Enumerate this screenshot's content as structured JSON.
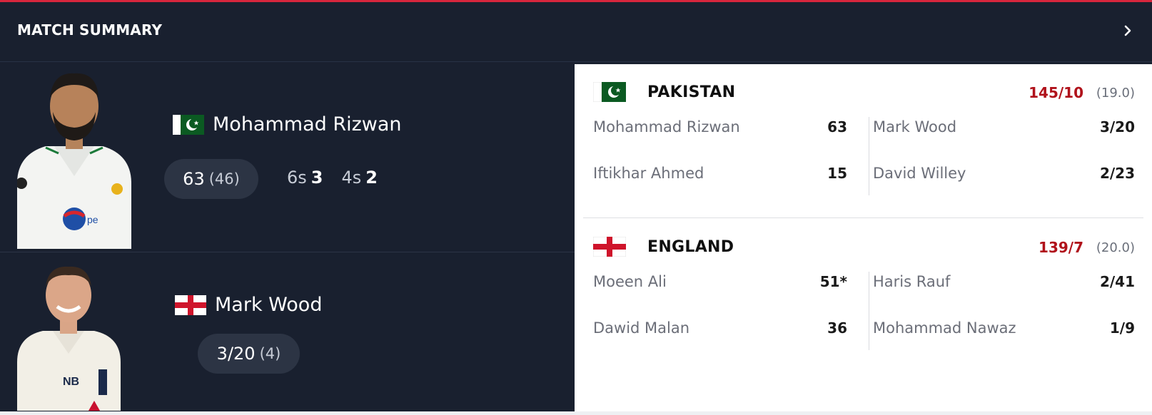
{
  "header": {
    "title": "MATCH SUMMARY"
  },
  "players": [
    {
      "name": "Mohammad Rizwan",
      "team": "Pakistan",
      "main_stat": "63",
      "main_stat_sub": "(46)",
      "sixes_label": "6s",
      "sixes": "3",
      "fours_label": "4s",
      "fours": "2"
    },
    {
      "name": "Mark Wood",
      "team": "England",
      "main_stat": "3/20",
      "main_stat_sub": "(4)"
    }
  ],
  "scorecard": {
    "teams": [
      {
        "name": "PAKISTAN",
        "score": "145/10",
        "overs": "(19.0)",
        "batters": [
          {
            "name": "Mohammad Rizwan",
            "value": "63"
          },
          {
            "name": "Iftikhar Ahmed",
            "value": "15"
          }
        ],
        "bowlers": [
          {
            "name": "Mark Wood",
            "value": "3/20"
          },
          {
            "name": "David Willey",
            "value": "2/23"
          }
        ]
      },
      {
        "name": "ENGLAND",
        "score": "139/7",
        "overs": "(20.0)",
        "batters": [
          {
            "name": "Moeen Ali",
            "value": "51*"
          },
          {
            "name": "Dawid Malan",
            "value": "36"
          }
        ],
        "bowlers": [
          {
            "name": "Haris Rauf",
            "value": "2/41"
          },
          {
            "name": "Mohammad Nawaz",
            "value": "1/9"
          }
        ]
      }
    ]
  },
  "colors": {
    "accent_red": "#d7263d",
    "score_red": "#b0121b",
    "panel_dark": "#19202f"
  },
  "icons": {
    "header_arrow": "chevron-right-icon",
    "pakistan_flag": "pakistan-flag-icon",
    "england_flag": "england-flag-icon"
  }
}
